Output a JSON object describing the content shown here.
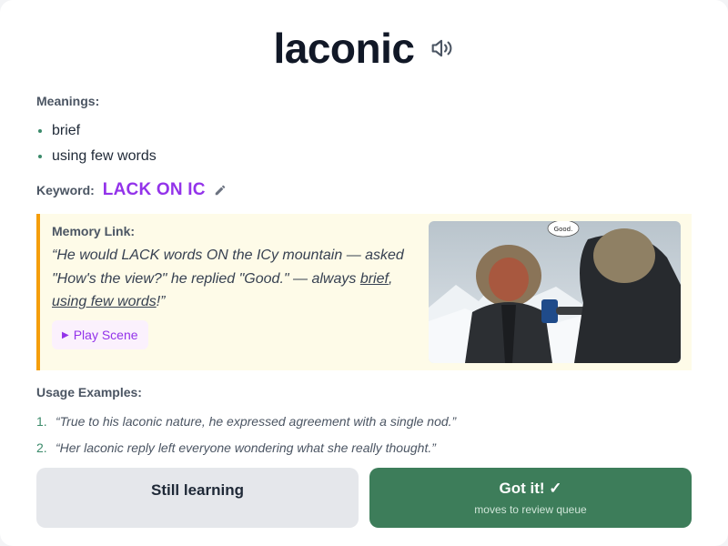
{
  "word": "laconic",
  "icons": {
    "speaker": "speaker-icon",
    "edit": "pencil-icon",
    "play": "play-icon"
  },
  "meanings": {
    "label": "Meanings:",
    "items": [
      "brief",
      "using few words"
    ]
  },
  "keyword": {
    "label": "Keyword:",
    "value": "LACK ON IC"
  },
  "memory": {
    "label": "Memory Link:",
    "text_parts": [
      "“He would LACK words ON the ICy mountain — asked \"How's the view?\" he replied \"Good.\" — always ",
      "brief",
      ", ",
      "using few words",
      "!”"
    ],
    "play_label": "Play Scene",
    "image_bubble": "Good."
  },
  "usage": {
    "label": "Usage Examples:",
    "items": [
      {
        "num": "1.",
        "text": "“True to his laconic nature, he expressed agreement with a single nod.”"
      },
      {
        "num": "2.",
        "text": "“Her laconic reply left everyone wondering what she really thought.”"
      }
    ]
  },
  "actions": {
    "still_learning": "Still learning",
    "got_it": "Got it! ✓",
    "got_it_sub": "moves to review queue"
  },
  "colors": {
    "accent_purple": "#9333ea",
    "accent_green": "#3d7d5a",
    "memory_border": "#f59e0b",
    "memory_bg": "#fefbe8"
  }
}
